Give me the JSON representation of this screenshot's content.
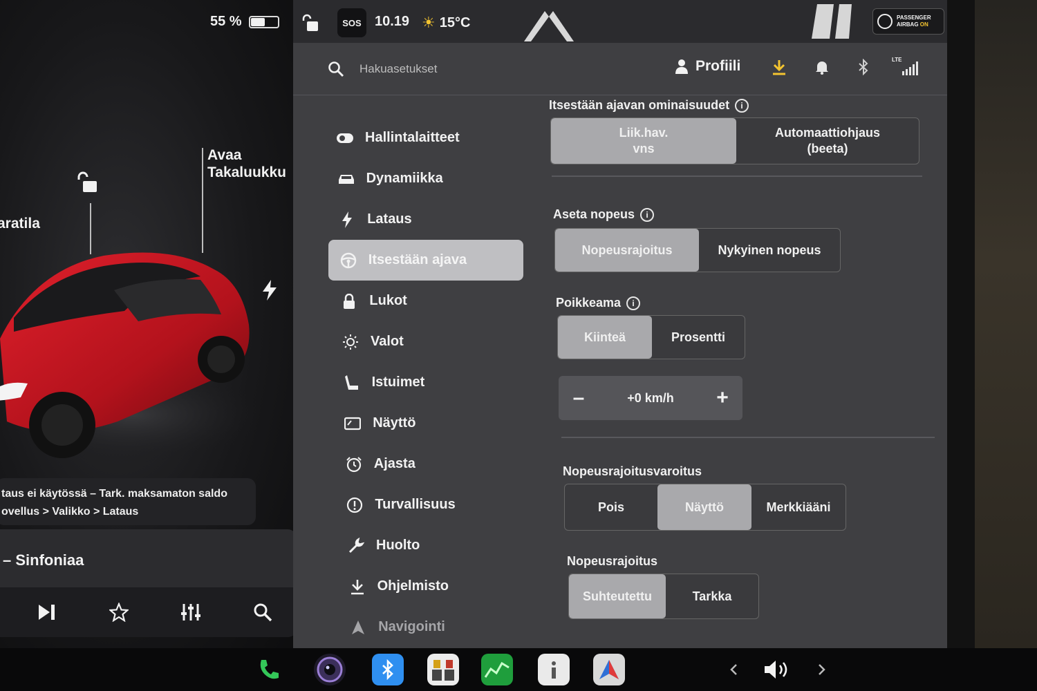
{
  "status": {
    "battery_percent_label": "55 %",
    "battery_level": 0.55,
    "sos_label": "SOS",
    "time": "10.19",
    "temperature": "15°C",
    "airbag_line1": "PASSENGER",
    "airbag_line2": "AIRBAG",
    "airbag_state": "ON",
    "cellular_label": "LTE"
  },
  "car": {
    "frunk_label": "aratila",
    "trunk_line1": "Avaa",
    "trunk_line2": "Takaluukku",
    "notice_line1": "taus ei käytössä – Tark. maksamaton saldo",
    "notice_line2": "ovellus > Valikko > Lataus"
  },
  "media": {
    "title": "– Sinfoniaa"
  },
  "topbar": {
    "search_placeholder": "Hakuasetukset",
    "profile_label": "Profiili"
  },
  "menu": {
    "items": [
      {
        "label": "Hallintalaitteet",
        "icon": "toggle-icon"
      },
      {
        "label": "Dynamiikka",
        "icon": "car-icon"
      },
      {
        "label": "Lataus",
        "icon": "bolt-icon"
      },
      {
        "label": "Itsestään ajava",
        "icon": "steering-wheel-icon",
        "active": true
      },
      {
        "label": "Lukot",
        "icon": "lock-icon"
      },
      {
        "label": "Valot",
        "icon": "sun-icon"
      },
      {
        "label": "Istuimet",
        "icon": "seat-icon"
      },
      {
        "label": "Näyttö",
        "icon": "display-icon"
      },
      {
        "label": "Ajasta",
        "icon": "alarm-clock-icon"
      },
      {
        "label": "Turvallisuus",
        "icon": "alert-icon"
      },
      {
        "label": "Huolto",
        "icon": "wrench-icon"
      },
      {
        "label": "Ohjelmisto",
        "icon": "download-icon"
      },
      {
        "label": "Navigointi",
        "icon": "navigation-icon"
      }
    ]
  },
  "autopilot": {
    "features_title": "Itsestään ajavan ominaisuudet",
    "features_options": [
      "Liik.hav.\nvns",
      "Automaattiohjaus\n(beeta)"
    ],
    "features_selected": 0,
    "set_speed_title": "Aseta nopeus",
    "set_speed_options": [
      "Nopeusrajoitus",
      "Nykyinen nopeus"
    ],
    "set_speed_selected": 0,
    "offset_title": "Poikkeama",
    "offset_options": [
      "Kiinteä",
      "Prosentti"
    ],
    "offset_selected": 0,
    "offset_value": "+0 km/h",
    "minus_label": "–",
    "plus_label": "+",
    "warning_title": "Nopeusrajoitusvaroitus",
    "warning_options": [
      "Pois",
      "Näyttö",
      "Merkkiääni"
    ],
    "warning_selected": 1,
    "limit_title": "Nopeusrajoitus",
    "limit_options": [
      "Suhteutettu",
      "Tarkka"
    ],
    "limit_selected": 0
  },
  "accent_colors": {
    "download": "#f4c430",
    "phone": "#34c759",
    "bluetooth": "#2f8ff0"
  }
}
